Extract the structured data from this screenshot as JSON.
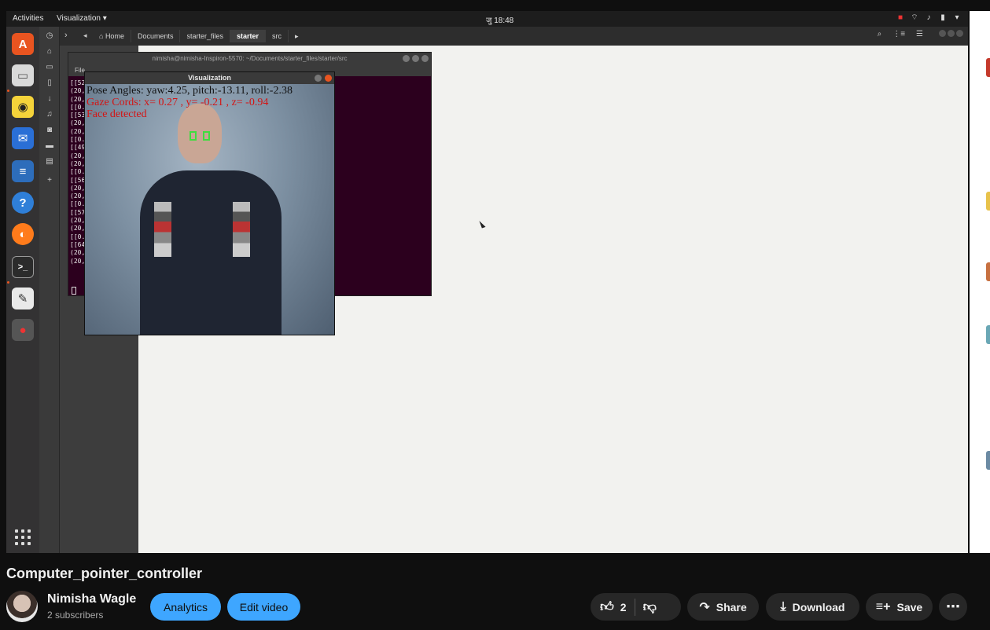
{
  "desktop": {
    "activities": "Activities",
    "app_menu": "Visualization ▾",
    "clock": "जु 18:48"
  },
  "files": {
    "breadcrumbs": [
      "Home",
      "Documents",
      "starter_files",
      "starter",
      "src"
    ]
  },
  "terminal": {
    "title": "nimisha@nimisha-Inspiron-5570: ~/Documents/starter_files/starter/src",
    "menu": "File",
    "lines": [
      "[[52",
      "(20,",
      "(20,",
      "[[0.",
      "[[53",
      "(20,",
      "(20,",
      "[[0.",
      "[[49",
      "(20,",
      "(20,",
      "[[0.",
      "[[56",
      "(20,",
      "(20,",
      "[[0.",
      "[[57",
      "(20,",
      "(20,",
      "[[0.",
      "[[64",
      "(20,",
      "(20,"
    ]
  },
  "visualization": {
    "title": "Visualization",
    "pose": "Pose Angles: yaw:4.25,  pitch:-13.11,  roll:-2.38",
    "gaze": "Gaze Cords: x= 0.27 , y= -0.21 , z= -0.94",
    "face": "Face detected"
  },
  "video": {
    "title": "Computer_pointer_controller",
    "channel": "Nimisha Wagle",
    "subscribers": "2 subscribers",
    "analytics": "Analytics",
    "edit_video": "Edit video",
    "likes": "2",
    "share": "Share",
    "download": "Download",
    "save": "Save",
    "more": "⋯"
  },
  "colors": {
    "accent_blue": "#3ea6ff",
    "ubuntu_orange": "#e95420"
  }
}
